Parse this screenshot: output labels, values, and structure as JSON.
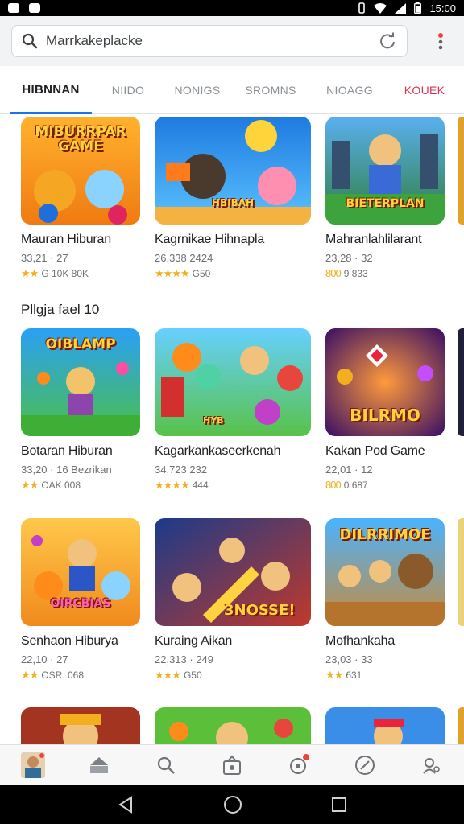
{
  "search": {
    "value": "Marrkakeplacke"
  },
  "tabs": [
    {
      "label": "HIBNNAN"
    },
    {
      "label": "NIIDO"
    },
    {
      "label": "NONIGS"
    },
    {
      "label": "SROMNS"
    },
    {
      "label": "NIOAGG"
    },
    {
      "label": "KOUEK"
    }
  ],
  "section2": {
    "title": "Pllgja fael 10"
  },
  "rows": [
    [
      {
        "thumb_text": "MIBURRPAR GAME",
        "title": "Mauran Hiburan",
        "meta": "33,21 · 27",
        "rating": "G 10K 80K",
        "stars": "★★"
      },
      {
        "thumb_text": "HBIBAH",
        "title": "Kagrnikae Hihnapla",
        "meta": "26,338 2424",
        "rating": "G50",
        "stars": "★★★★"
      },
      {
        "thumb_text": "BIETERPLAN",
        "title": "Mahranlahlilarant",
        "meta": "23,28 · 32",
        "rating": "9 833",
        "stars": "800"
      }
    ],
    [
      {
        "thumb_text": "OIBLAMP",
        "title": "Botaran Hiburan",
        "meta": "33,20 · 16 Bezrikan",
        "rating": "OAK 008",
        "stars": "★★"
      },
      {
        "thumb_text": "HYB",
        "title": "Kagarkankaseerkenah",
        "meta": "34,723 232",
        "rating": "444",
        "stars": "★★★★"
      },
      {
        "thumb_text": "BILRMO",
        "title": "Kakan Pod Game",
        "meta": "22,01 · 12",
        "rating": "0 687",
        "stars": "800"
      }
    ],
    [
      {
        "thumb_text": "OIRCBIAS",
        "title": "Senhaon Hiburya",
        "meta": "22,10 · 27",
        "rating": "OSR. 068",
        "stars": "★★"
      },
      {
        "thumb_text": "3NOSSE!",
        "title": "Kuraing Aikan",
        "meta": "22,313 · 249",
        "rating": "G50",
        "stars": "★★★"
      },
      {
        "thumb_text": "DILRRIMOE",
        "title": "Mofhankaha",
        "meta": "23,03 · 33",
        "rating": "631",
        "stars": "★★"
      }
    ]
  ],
  "status": {
    "time": "15:00"
  },
  "colors": {
    "accent": "#1a73e8",
    "star": "#f2b01e",
    "tab_red": "#d93556"
  }
}
